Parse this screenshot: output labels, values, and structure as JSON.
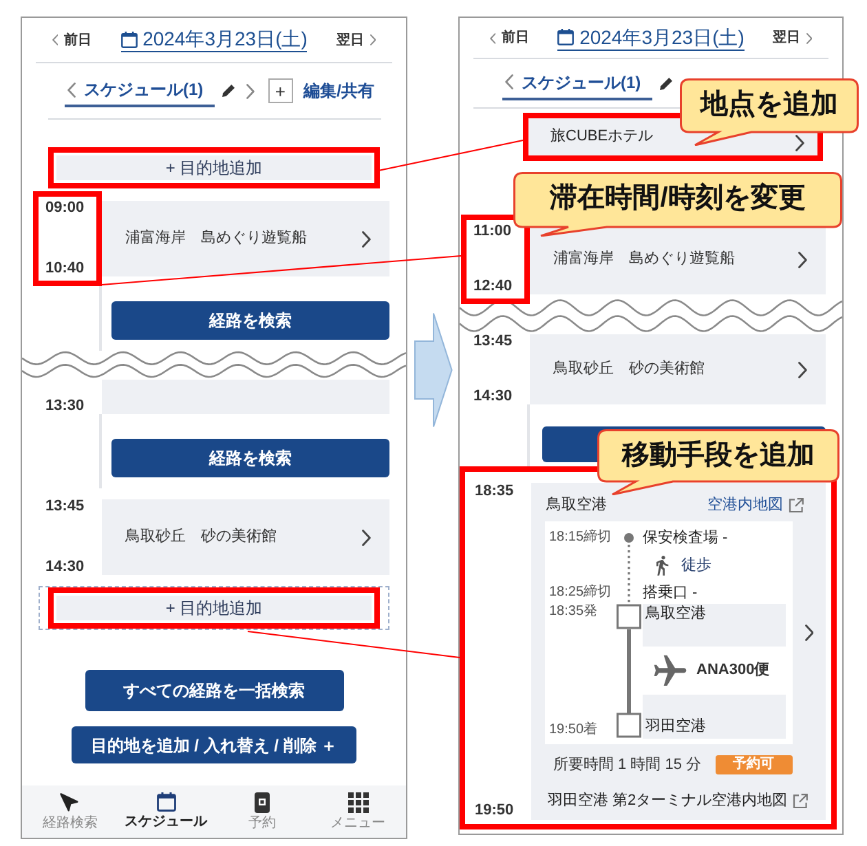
{
  "screens": [
    {
      "header": {
        "prev": "前日",
        "date": "2024年3月23日(土)",
        "next": "翌日"
      },
      "tab_bar": {
        "tab": "スケジュール(1)",
        "add_button": "+",
        "edit_share": "編集/共有"
      },
      "timeline": [
        {
          "kind": "add",
          "label": "+ 目的地追加",
          "highlighted": true,
          "dashed": false
        },
        {
          "kind": "stop",
          "start": "09:00",
          "end": "10:40",
          "name": "浦富海岸　島めぐり遊覧船",
          "time_highlighted": true
        },
        {
          "kind": "route",
          "label": "経路を検索"
        },
        {
          "kind": "cut"
        },
        {
          "kind": "stop",
          "end": "13:30",
          "time_highlighted": false
        },
        {
          "kind": "route",
          "label": "経路を検索"
        },
        {
          "kind": "stop",
          "start": "13:45",
          "end": "14:30",
          "name": "鳥取砂丘　砂の美術館",
          "time_highlighted": false
        },
        {
          "kind": "add",
          "label": "+ 目的地追加",
          "highlighted": true,
          "dashed": true
        }
      ],
      "actions": [
        "すべての経路を一括検索",
        "目的地を追加 / 入れ替え / 削除 ＋"
      ],
      "nav": [
        {
          "label": "経路検索",
          "selected": false
        },
        {
          "label": "スケジュール",
          "selected": true
        },
        {
          "label": "予約",
          "selected": false
        },
        {
          "label": "メニュー",
          "selected": false
        }
      ]
    },
    {
      "header": {
        "prev": "前日",
        "date": "2024年3月23日(土)",
        "next": "翌日"
      },
      "tab_bar": {
        "tab": "スケジュール(1)"
      },
      "timeline": [
        {
          "kind": "place",
          "name": "旅CUBEホテル",
          "highlighted": true,
          "callout": "地点を追加"
        },
        {
          "kind": "stop",
          "start": "11:00",
          "end": "12:40",
          "name": "浦富海岸　島めぐり遊覧船",
          "time_highlighted": true,
          "callout": "滞在時間/時刻を変更"
        },
        {
          "kind": "cut"
        },
        {
          "kind": "stop",
          "start": "13:45",
          "end": "14:30",
          "name": "鳥取砂丘　砂の美術館",
          "time_highlighted": false
        },
        {
          "kind": "route"
        },
        {
          "kind": "transit",
          "start": "18:35",
          "end": "19:50",
          "highlighted": true,
          "callout": "移動手段を追加",
          "from": "鳥取空港",
          "from_map": "空港内地図",
          "steps": [
            {
              "kind": "checkpoint",
              "time": "18:15締切",
              "label": "保安検査場 -"
            },
            {
              "kind": "walk",
              "label": "徒歩"
            },
            {
              "kind": "checkpoint",
              "time": "18:25締切",
              "label": "搭乗口 -"
            },
            {
              "kind": "depart",
              "time": "18:35発",
              "label": "鳥取空港"
            },
            {
              "kind": "flight",
              "label": "ANA300便"
            },
            {
              "kind": "arrive",
              "time": "19:50着",
              "label": "羽田空港"
            }
          ],
          "duration": "所要時間 1 時間 15 分",
          "badge": "予約可",
          "to_map": "羽田空港 第2ターミナル空港内地図"
        }
      ]
    }
  ]
}
